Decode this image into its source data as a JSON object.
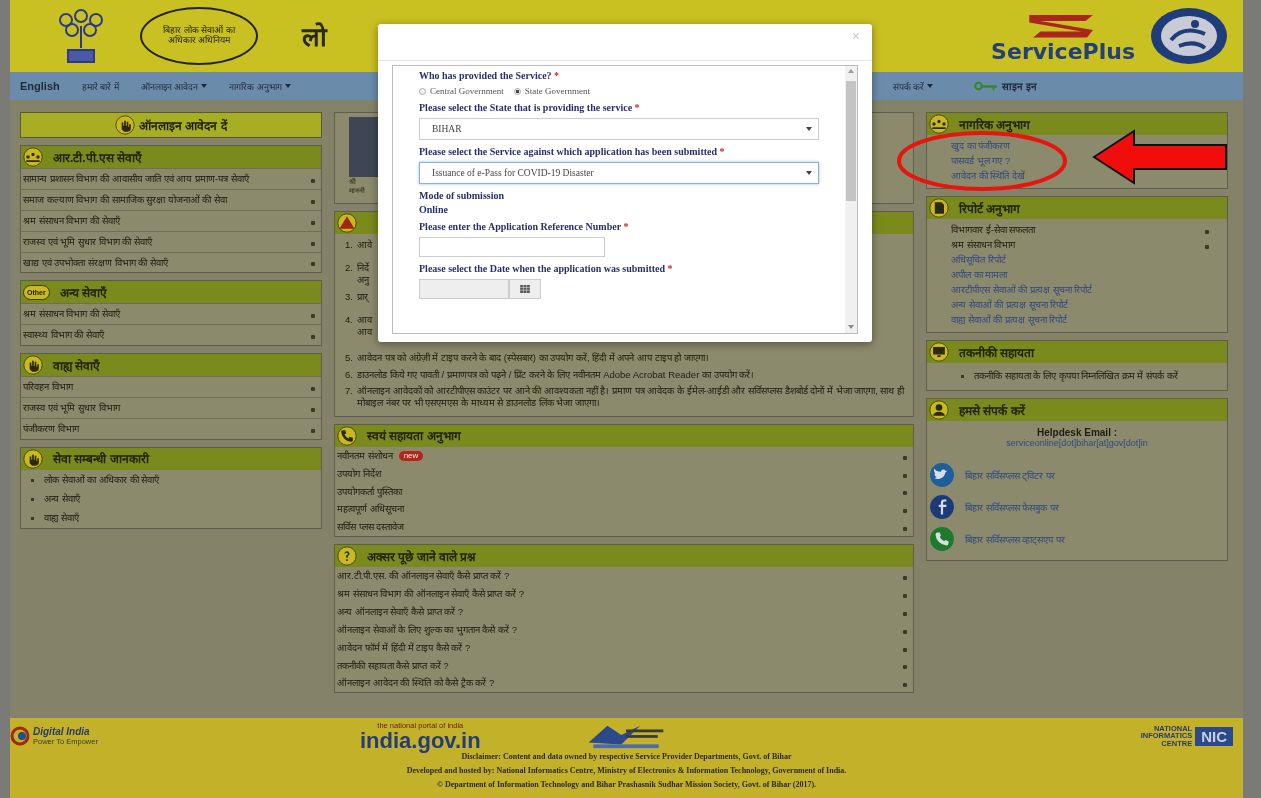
{
  "header": {
    "emblem_text": "बिहार लोक सेवाओं का अधिकार अधिनियम",
    "title": "लो",
    "brand": "ServicePlus"
  },
  "nav": {
    "left": [
      {
        "label": "English",
        "kind": "lang"
      },
      {
        "label": "हमारे बारे में",
        "kind": "link"
      },
      {
        "label": "ऑनलाइन आवेदन",
        "kind": "menu"
      },
      {
        "label": "नागरिक अनुभाग",
        "kind": "menu"
      }
    ],
    "right": [
      {
        "label": "संपर्क करें",
        "kind": "menu"
      },
      {
        "label": "साइन इन",
        "kind": "signin"
      }
    ]
  },
  "left": {
    "apply_button": "ऑनलाइन आवेदन दें",
    "panels": [
      {
        "title": "आर.टी.पी.एस सेवाएँ",
        "items": [
          {
            "label": "सामान्य प्रशासन विभाग की आवासीय जाति एवं आय प्रमाण-पत्र सेवाएँ",
            "kind": "accordion"
          },
          {
            "label": "समाज कल्याण विभाग की सामाजिक सुरक्षा योजनाओं की सेवा",
            "kind": "accordion"
          },
          {
            "label": "श्रम संसाधन विभाग की सेवाएँ",
            "kind": "accordion"
          },
          {
            "label": "राजस्व एवं भूमि सुधार विभाग की सेवाएँ",
            "kind": "accordion"
          },
          {
            "label": "खाद्य एवं उपभोक्ता संरक्षण विभाग की सेवाएँ",
            "kind": "accordion"
          }
        ]
      },
      {
        "title": "अन्य सेवाएँ",
        "badge": "Other",
        "items": [
          {
            "label": "श्रम संसाधन विभाग की सेवाएँ",
            "kind": "accordion"
          },
          {
            "label": "स्वास्थ्य विभाग की सेवाएँ",
            "kind": "accordion"
          }
        ]
      },
      {
        "title": "वाह्य सेवाएँ",
        "items": [
          {
            "label": "परिवहन विभाग",
            "kind": "accordion"
          },
          {
            "label": "राजस्व एवं भूमि सुधार विभाग",
            "kind": "accordion"
          },
          {
            "label": "पंजीकरण विभाग",
            "kind": "accordion"
          }
        ]
      },
      {
        "title": "सेवा सम्बन्धी जानकारी",
        "items": [
          {
            "label": "लोक सेवाओं का अधिकार की सेवाएँ",
            "kind": "bullet"
          },
          {
            "label": "अन्य सेवाएँ",
            "kind": "bullet"
          },
          {
            "label": "वाह्य सेवाएँ",
            "kind": "bullet"
          }
        ]
      }
    ]
  },
  "center": {
    "photo_caption": [
      "श्री",
      "माननी"
    ],
    "instructions": [
      {
        "number": "1.",
        "text": "आवे",
        "kind": "partial"
      },
      {
        "number": "2.",
        "text": "निर्दे अनु",
        "kind": "partial"
      },
      {
        "number": "3.",
        "text": "प्रार्",
        "kind": "partial"
      },
      {
        "number": "4.",
        "text": "आव आव",
        "kind": "partial"
      },
      {
        "number": "5.",
        "text": "आवेदन पत्र को अंग्रेज़ी में टाइप करने के बाद (स्पेसबार) का उपयोग करें, हिंदी में अपने आप टाइप हो जाएगा।",
        "kind": "full"
      },
      {
        "number": "6.",
        "text": "डाउनलोड किये गए पावती / प्रमाणपत्र को पढ़ने / प्रिंट करने के लिए नवीनतम Adobe Acrobat Reader का उपयोग करें।",
        "kind": "full"
      },
      {
        "number": "7.",
        "text": "ऑनलाइन आवेदकों को आरटीपीएस काउंटर पर आने की आवश्यकता नहीं है। प्रमाण पत्र आवेदक के ईमेल-आईडी और सर्विसप्लस डैशबोर्ड दोनों में भेजा जाएगा, साथ ही मोबाइल नंबर पर भी एसएमएस के माध्यम से डाउनलोड लिंक भेजा जाएगा।",
        "kind": "full"
      }
    ],
    "panels": [
      {
        "title": "स्वयं सहायता अनुभाग",
        "items": [
          {
            "label": "नवीनतम संशोधन",
            "kind": "accordion",
            "badge": "new"
          },
          {
            "label": "उपयोग निर्देश",
            "kind": "accordion"
          },
          {
            "label": "उपयोगकर्ता पुस्तिका",
            "kind": "accordion"
          },
          {
            "label": "महत्वपूर्ण अधिसूचना",
            "kind": "accordion"
          },
          {
            "label": "सर्विस प्लस दस्तावेज",
            "kind": "accordion"
          }
        ]
      },
      {
        "title": "अक्सर पूछे जाने वाले प्रश्न",
        "items": [
          {
            "label": "आर.टी.पी.एस. की ऑनलाइन सेवाएँ कैसे प्राप्त करें ?",
            "kind": "accordion"
          },
          {
            "label": "श्रम संसाधन विभाग की ऑनलाइन सेवाएँ कैसे प्राप्त करें ?",
            "kind": "accordion"
          },
          {
            "label": "अन्य ऑनलाइन सेवाएँ कैसे प्राप्त करें ?",
            "kind": "accordion"
          },
          {
            "label": "ऑनलाइन सेवाओं के लिए शुल्क का भुगतान कैसे करें ?",
            "kind": "accordion"
          },
          {
            "label": "आवेदन फॉर्म में हिंदी में टाइप कैसे करें ?",
            "kind": "accordion"
          },
          {
            "label": "तकनीकी सहायता कैसे प्राप्त करें ?",
            "kind": "accordion"
          },
          {
            "label": "ऑनलाइन आवेदन की स्थिति को कैसे ट्रैक करें ?",
            "kind": "accordion"
          }
        ]
      }
    ]
  },
  "right": {
    "panels": [
      {
        "title": "नागरिक अनुभाग",
        "items": [
          {
            "label": "खुद का पंजीकरण",
            "kind": "link"
          },
          {
            "label": "पासवर्ड भूल गए ?",
            "kind": "link"
          },
          {
            "label": "आवेदन की स्थिति देखें",
            "kind": "link"
          }
        ]
      },
      {
        "title": "रिपोर्ट अनुभाग",
        "items": [
          {
            "label": "विभागवार ई-सेवा सफलता",
            "kind": "accordion"
          },
          {
            "label": "श्रम संसाधन विभाग",
            "kind": "accordion"
          },
          {
            "label": "अधिसूचित रिपोर्ट",
            "kind": "link"
          },
          {
            "label": "अपील का मामला",
            "kind": "link"
          },
          {
            "label": "आरटीपीएस सेवाओं की प्रत्यक्ष सूचना रिपोर्ट",
            "kind": "link"
          },
          {
            "label": "अन्य सेवाओं की प्रत्यक्ष सूचना रिपोर्ट",
            "kind": "link"
          },
          {
            "label": "वाह्य सेवाओं की प्रत्यक्ष सूचना रिपोर्ट",
            "kind": "link"
          }
        ]
      },
      {
        "title": "तकनीकी सहायता",
        "items": [
          {
            "label": "तकनीकि सहायता के लिए कृपया निम्नलिखित क्रम में संपर्क करें",
            "kind": "bullet"
          }
        ]
      }
    ],
    "contact": {
      "title": "हमसे संपर्क करें",
      "helpdesk_label": "Helpdesk Email :",
      "email": "serviceonline[dot]bihar[at]gov[dot]in",
      "social": [
        {
          "label": "बिहार सर्विसप्लस ट्विटर पर"
        },
        {
          "label": "बिहार सर्विसप्लस फेसबुक पर"
        },
        {
          "label": "बिहार सर्विसप्लस व्हाट्सएप पर"
        }
      ]
    }
  },
  "modal": {
    "close": "×",
    "fields": [
      {
        "kind": "radio",
        "label": "Who has provided the Service?",
        "required_mark": "*",
        "options": [
          {
            "label": "Central Government",
            "selected": false
          },
          {
            "label": "State Government",
            "selected": true
          }
        ]
      },
      {
        "kind": "select",
        "label": "Please select the State that is providing the service",
        "required_mark": "*",
        "value": "BIHAR",
        "focused": false
      },
      {
        "kind": "select",
        "label": "Please select the Service against which application has been submitted",
        "required_mark": "*",
        "value": "Issuance of e-Pass for COVID-19 Disaster",
        "focused": true
      },
      {
        "kind": "static",
        "label": "Mode of submission",
        "value": "Online"
      },
      {
        "kind": "text",
        "label": "Please enter the Application Reference Number",
        "required_mark": "*"
      },
      {
        "kind": "date",
        "label": "Please select the Date when the application was submitted",
        "required_mark": "*"
      }
    ]
  },
  "footer": {
    "digital_india": "Digital India",
    "digital_india_tag": "Power To Empower",
    "portal": "india.gov.in",
    "portal_tag": "the national portal of india",
    "nic_text": "NATIONAL INFORMATICS CENTRE",
    "nic": "NIC",
    "lines": [
      "Disclaimer: Content and data owned by respective Service Provider Departments, Govt. of Bihar",
      "Developed and hosted by: National Informatics Centre, Ministry of Electronics & Information Technology, Government of India.",
      "© Department of Information Technology and Bihar Prashasnik Sudhar Mission Society, Govt. of Bihar (2017)."
    ]
  }
}
